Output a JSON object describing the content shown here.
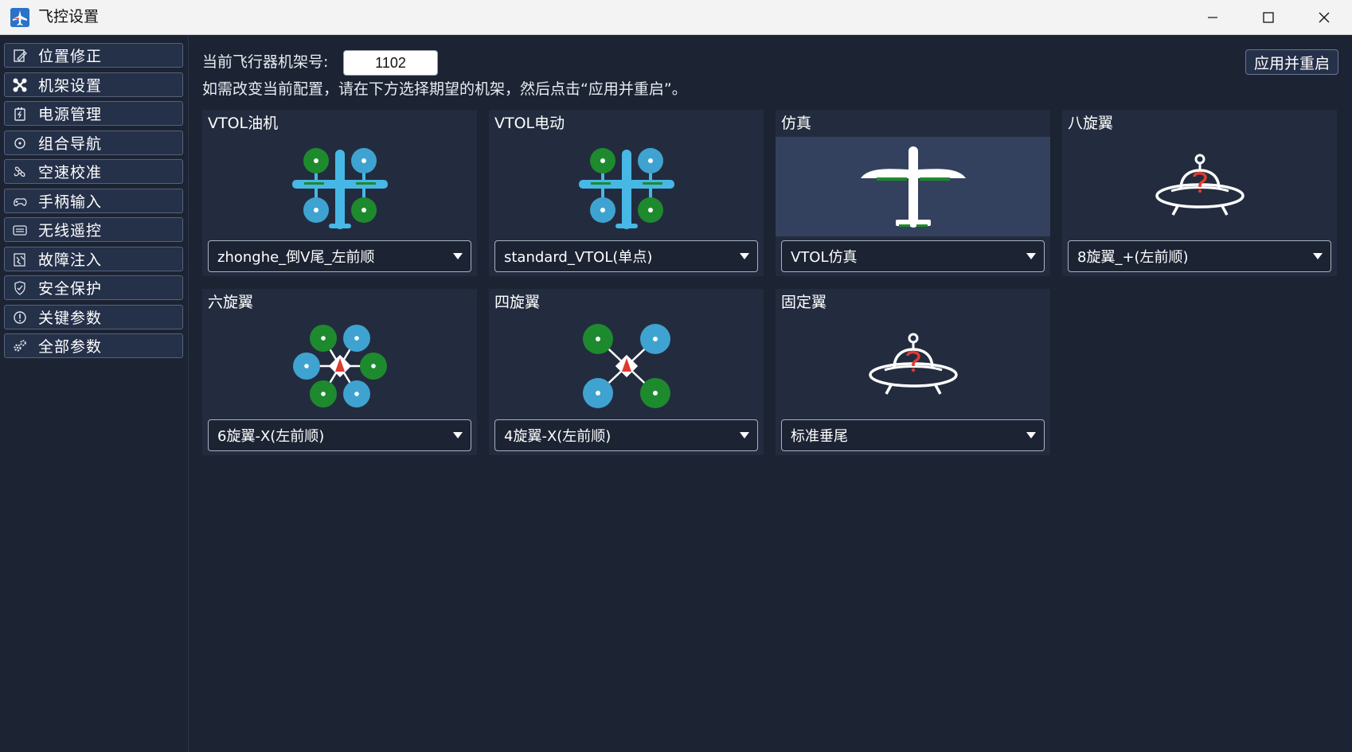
{
  "window": {
    "title": "飞控设置",
    "app_icon": "plane-icon"
  },
  "sidebar": {
    "items": [
      {
        "label": "位置修正",
        "icon": "position-correction-icon"
      },
      {
        "label": "机架设置",
        "icon": "drone-frame-icon"
      },
      {
        "label": "电源管理",
        "icon": "battery-icon"
      },
      {
        "label": "组合导航",
        "icon": "navigation-icon"
      },
      {
        "label": "空速校准",
        "icon": "airspeed-icon"
      },
      {
        "label": "手柄输入",
        "icon": "gamepad-icon"
      },
      {
        "label": "无线遥控",
        "icon": "radio-remote-icon"
      },
      {
        "label": "故障注入",
        "icon": "fault-injection-icon"
      },
      {
        "label": "安全保护",
        "icon": "shield-icon"
      },
      {
        "label": "关键参数",
        "icon": "alert-icon"
      },
      {
        "label": "全部参数",
        "icon": "gears-icon"
      }
    ]
  },
  "main": {
    "current_frame_label": "当前飞行器机架号:",
    "current_frame_value": "1102",
    "hint": "如需改变当前配置，请在下方选择期望的机架，然后点击“应用并重启”。",
    "apply_button": "应用并重启"
  },
  "cards": [
    {
      "title": "VTOL油机",
      "selected_option": "zhonghe_倒V尾_左前顺",
      "image": "vtol-icon"
    },
    {
      "title": "VTOL电动",
      "selected_option": "standard_VTOL(单点)",
      "image": "vtol-icon"
    },
    {
      "title": "仿真",
      "selected_option": "VTOL仿真",
      "image": "fixed-wing-plane-icon",
      "highlighted": true
    },
    {
      "title": "八旋翼",
      "selected_option": "8旋翼_+(左前顺)",
      "image": "unknown-ufo-icon"
    },
    {
      "title": "六旋翼",
      "selected_option": "6旋翼-X(左前顺)",
      "image": "hexacopter-icon"
    },
    {
      "title": "四旋翼",
      "selected_option": "4旋翼-X(左前顺)",
      "image": "quadcopter-icon"
    },
    {
      "title": "固定翼",
      "selected_option": "标准垂尾",
      "image": "unknown-ufo-icon"
    }
  ],
  "colors": {
    "background": "#1c2333",
    "card": "#232c3e",
    "card_highlight": "#34415e",
    "rotor_green": "#1e8a2e",
    "rotor_blue": "#3fa3d1",
    "airframe_blue": "#47b8e6",
    "accent_red": "#e03a2f"
  }
}
